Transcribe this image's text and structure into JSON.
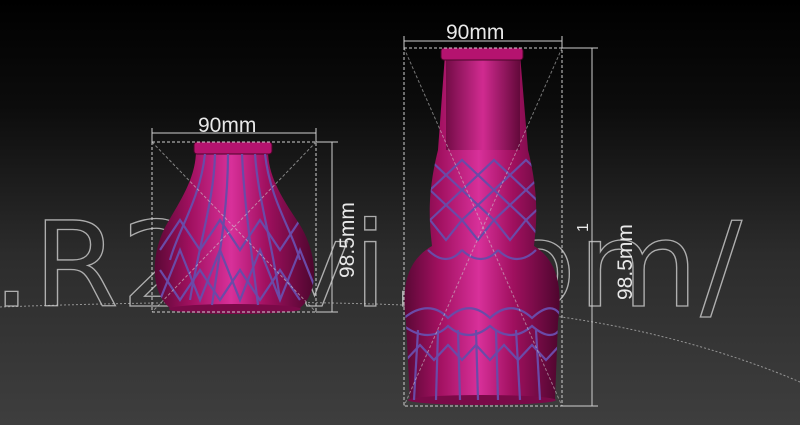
{
  "watermark": {
    "text": ".R2Pvi.com/"
  },
  "objects": {
    "small_vase": {
      "width_label": "90mm",
      "height_label": "98.5mm"
    },
    "tall_vase": {
      "width_label": "90mm",
      "height_label": "98.5mm",
      "side_marker": "1"
    }
  },
  "colors": {
    "vase_body": "#a0105f",
    "vase_highlight": "#d8309a",
    "vase_shadow": "#5a0835",
    "rope": "#6a4aa8",
    "dimension_lines": "#d0d0d0",
    "background_top": "#000000",
    "background_bottom": "#3e3e3e"
  }
}
